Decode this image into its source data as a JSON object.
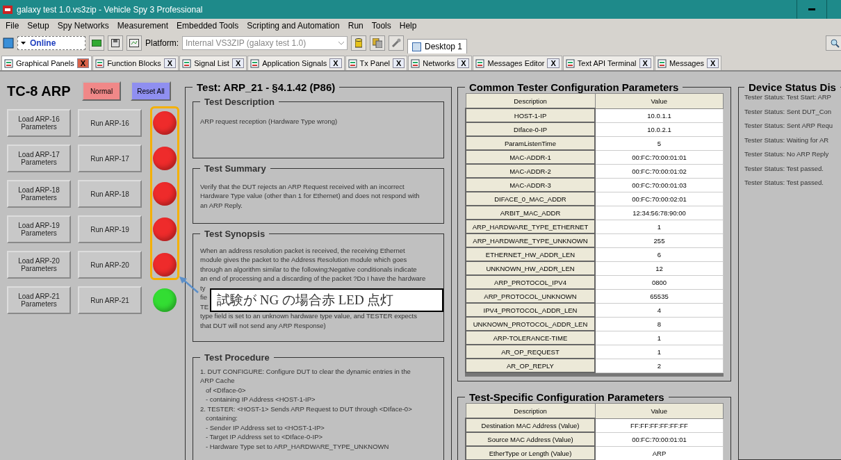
{
  "window": {
    "title": "galaxy test 1.0.vs3zip - Vehicle Spy 3 Professional"
  },
  "menu": [
    "File",
    "Setup",
    "Spy Networks",
    "Measurement",
    "Embedded Tools",
    "Scripting and Automation",
    "Run",
    "Tools",
    "Help"
  ],
  "toolbar": {
    "mode": "Online",
    "platform_label": "Platform:",
    "platform_value": "Internal VS3ZIP (galaxy test 1.0)",
    "desktop_tab": "Desktop 1"
  },
  "tabs": [
    {
      "label": "Graphical Panels",
      "close": "X",
      "selected": true
    },
    {
      "label": "Function Blocks",
      "close": "X",
      "selected": false
    },
    {
      "label": "Signal List",
      "close": "X",
      "selected": false
    },
    {
      "label": "Application Signals",
      "close": "X",
      "selected": false
    },
    {
      "label": "Tx Panel",
      "close": "X",
      "selected": false
    },
    {
      "label": "Networks",
      "close": "X",
      "selected": false
    },
    {
      "label": "Messages Editor",
      "close": "X",
      "selected": false
    },
    {
      "label": "Text API Terminal",
      "close": "X",
      "selected": false
    },
    {
      "label": "Messages",
      "close": "X",
      "selected": false
    }
  ],
  "panel": {
    "title": "TC-8 ARP",
    "buttons": [
      {
        "label": "Normal",
        "kind": "normal"
      },
      {
        "label": "Reset All",
        "kind": "reset"
      }
    ],
    "tests": [
      {
        "load": "Load ARP-16 Parameters",
        "run": "Run ARP-16",
        "color": "#ee2b2b"
      },
      {
        "load": "Load ARP-17 Parameters",
        "run": "Run ARP-17",
        "color": "#ee2b2b"
      },
      {
        "load": "Load ARP-18 Parameters",
        "run": "Run ARP-18",
        "color": "#ee2b2b"
      },
      {
        "load": "Load ARP-19 Parameters",
        "run": "Run ARP-19",
        "color": "#ee2b2b"
      },
      {
        "load": "Load ARP-20 Parameters",
        "run": "Run ARP-20",
        "color": "#ee2b2b"
      },
      {
        "load": "Load ARP-21 Parameters",
        "run": "Run ARP-21",
        "color": "#33dd33"
      }
    ]
  },
  "test": {
    "title": "Test: ARP_21  - §4.1.42 (P86)",
    "sections": [
      {
        "title": "Test Description",
        "lines": [
          "ARP request reception (Hardware Type wrong)"
        ]
      },
      {
        "title": "Test Summary",
        "lines": [
          "Verify that the DUT rejects an ARP Request received with an incorrect",
          "Hardware Type value (other than 1 for Ethernet) and does not respond with",
          "an ARP Reply."
        ]
      },
      {
        "title": "Test Synopsis",
        "lines": [
          "When an address resolution packet is received, the receiving Ethernet",
          "module gives the packet to the Address Resolution module which goes",
          "through an algorithm similar to the following:Negative conditionals indicate",
          "an end of processing and a discarding of the packet ?Do I have the hardware",
          "ty",
          "fie",
          "TE",
          "type field is set to an unknown hardware type value, and TESTER expects",
          "that DUT will not send any ARP Response)"
        ]
      },
      {
        "title": "Test Procedure",
        "lines": [
          "1. DUT CONFIGURE: Configure DUT to clear the dynamic entries in the",
          "ARP Cache",
          "   of <DIface-0>",
          "   - containing IP Address <HOST-1-IP>",
          "2. TESTER: <HOST-1> Sends ARP Request to DUT through <DIface-0>",
          "   containing:",
          "   - Sender IP Address set to <HOST-1-IP>",
          "   - Target IP Address set to <DIface-0-IP>",
          "   - Hardware Type set to ARP_HARDWARE_TYPE_UNKNOWN"
        ]
      }
    ]
  },
  "common_config": {
    "title": "Common Tester Configuration Parameters",
    "columns": [
      "Description",
      "Value"
    ],
    "rows": [
      [
        "HOST-1-IP",
        "10.0.1.1"
      ],
      [
        "DIface-0-IP",
        "10.0.2.1"
      ],
      [
        "ParamListenTime",
        "5"
      ],
      [
        "MAC-ADDR-1",
        "00:FC:70:00:01:01"
      ],
      [
        "MAC-ADDR-2",
        "00:FC:70:00:01:02"
      ],
      [
        "MAC-ADDR-3",
        "00:FC:70:00:01:03"
      ],
      [
        "DIFACE_0_MAC_ADDR",
        "00:FC:70:00:02:01"
      ],
      [
        "ARBIT_MAC_ADDR",
        "12:34:56:78:90:00"
      ],
      [
        "ARP_HARDWARE_TYPE_ETHERNET",
        "1"
      ],
      [
        "ARP_HARDWARE_TYPE_UNKNOWN",
        "255"
      ],
      [
        "ETHERNET_HW_ADDR_LEN",
        "6"
      ],
      [
        "UNKNOWN_HW_ADDR_LEN",
        "12"
      ],
      [
        "ARP_PROTOCOL_IPV4",
        "0800"
      ],
      [
        "ARP_PROTOCOL_UNKNOWN",
        "65535"
      ],
      [
        "IPV4_PROTOCOL_ADDR_LEN",
        "4"
      ],
      [
        "UNKNOWN_PROTOCOL_ADDR_LEN",
        "8"
      ],
      [
        "ARP-TOLERANCE-TIME",
        "1"
      ],
      [
        "AR_OP_REQUEST",
        "1"
      ],
      [
        "AR_OP_REPLY",
        "2"
      ]
    ]
  },
  "specific_config": {
    "title": "Test-Specific Configuration Parameters",
    "columns": [
      "Description",
      "Value"
    ],
    "rows": [
      [
        "Destination MAC Address (Value)",
        "FF:FF:FF:FF:FF:FF"
      ],
      [
        "Source MAC Address (Value)",
        "00:FC:70:00:01:01"
      ],
      [
        "EtherType or Length (Value)",
        "ARP"
      ]
    ]
  },
  "device_status": {
    "title": "Device Status Dis",
    "lines": [
      "Tester Status: Test Start: ARP",
      "Tester Status: Sent DUT_Con",
      "Tester Status: Sent ARP Requ",
      "Tester Status: Waiting for AR",
      "Tester Status: No ARP Reply",
      "Tester Status: Test passed.",
      "Tester Status: Test passed."
    ]
  },
  "callout": {
    "text": "試験が NG の場合赤 LED 点灯"
  }
}
